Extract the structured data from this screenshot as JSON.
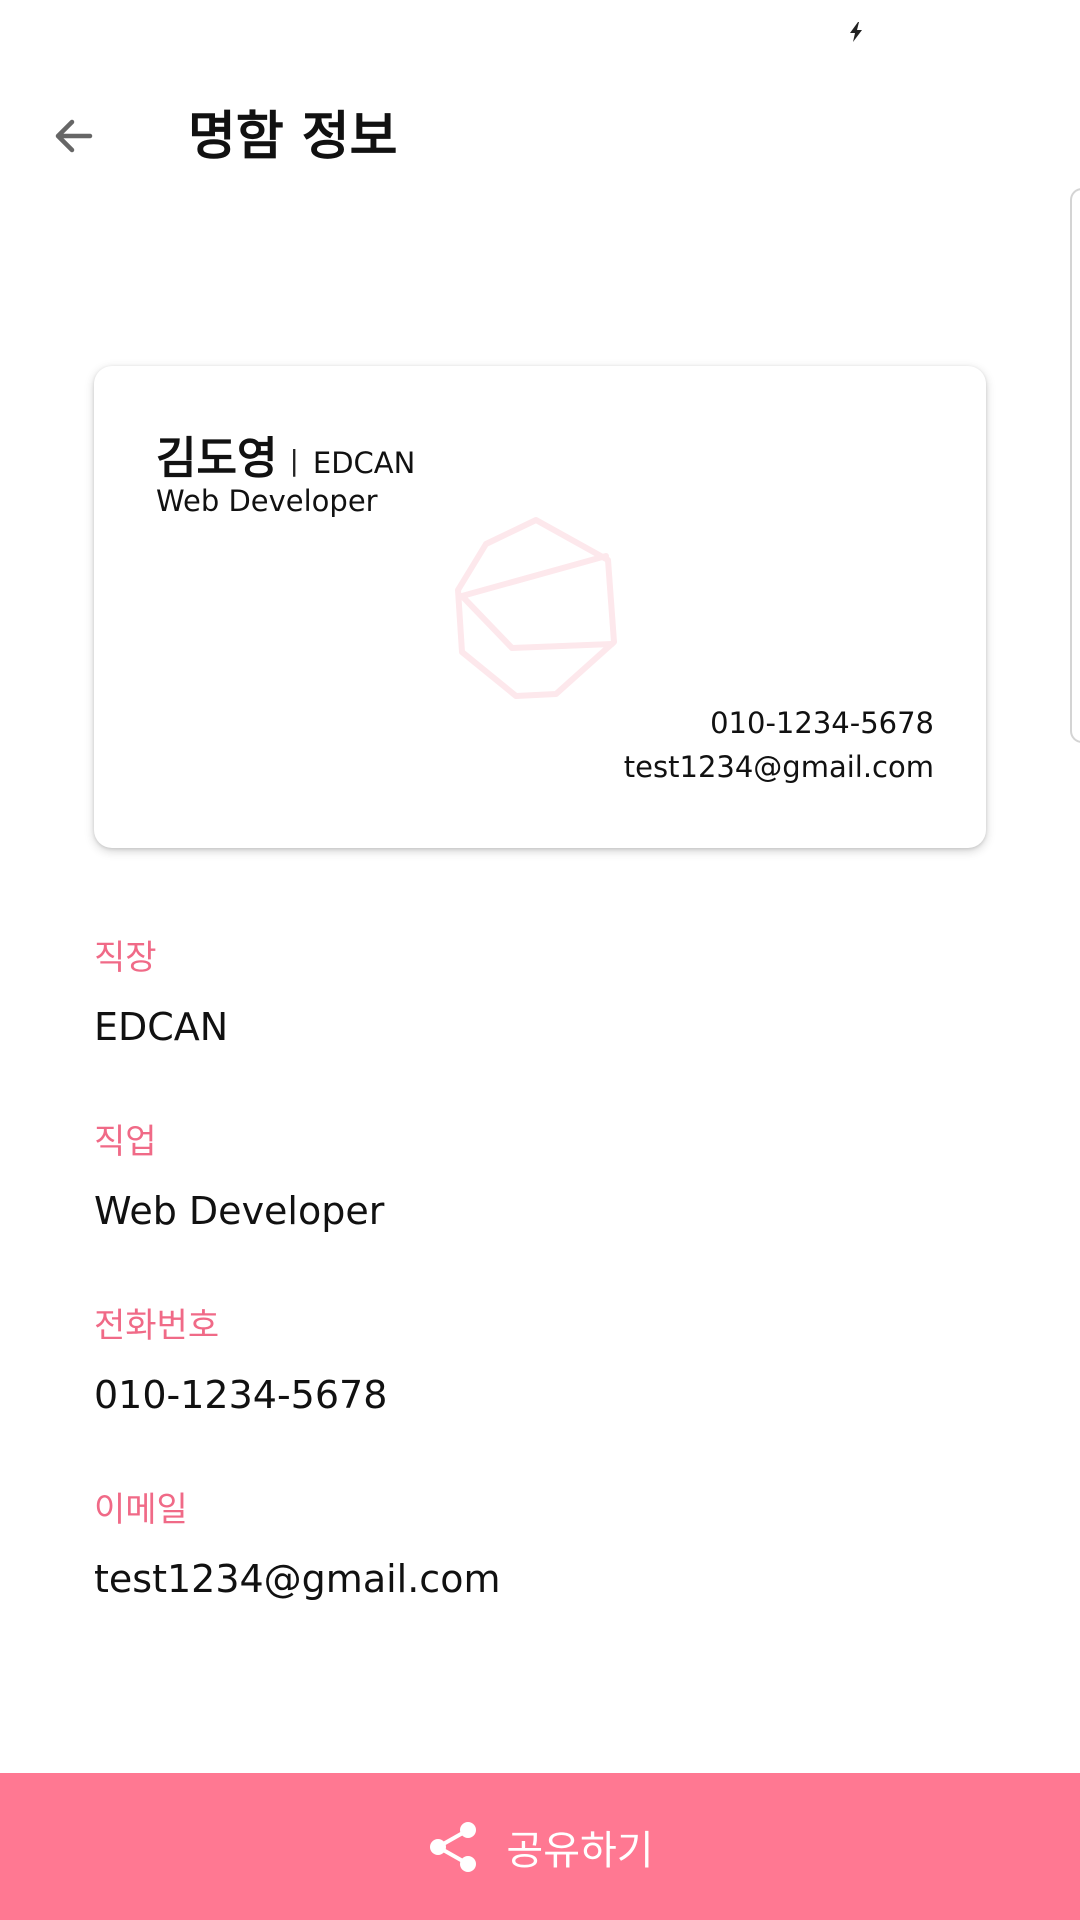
{
  "status_bar": {
    "icons": [
      "charging-bolt-icon"
    ]
  },
  "app_bar": {
    "back_icon": "arrow-left-icon",
    "title": "명함 정보"
  },
  "card": {
    "name": "김도영",
    "divider": "|",
    "company": "EDCAN",
    "job": "Web Developer",
    "phone": "010-1234-5678",
    "email": "test1234@gmail.com",
    "logo_icon": "hexagon-logo-icon"
  },
  "details": [
    {
      "label": "직장",
      "value": "EDCAN"
    },
    {
      "label": "직업",
      "value": "Web Developer"
    },
    {
      "label": "전화번호",
      "value": "010-1234-5678"
    },
    {
      "label": "이메일",
      "value": "test1234@gmail.com"
    }
  ],
  "share": {
    "icon": "share-icon",
    "label": "공유하기"
  },
  "colors": {
    "accent": "#ff7892",
    "label_pink": "#f06a87",
    "logo_faint": "#fde8ec",
    "text": "#111111"
  }
}
